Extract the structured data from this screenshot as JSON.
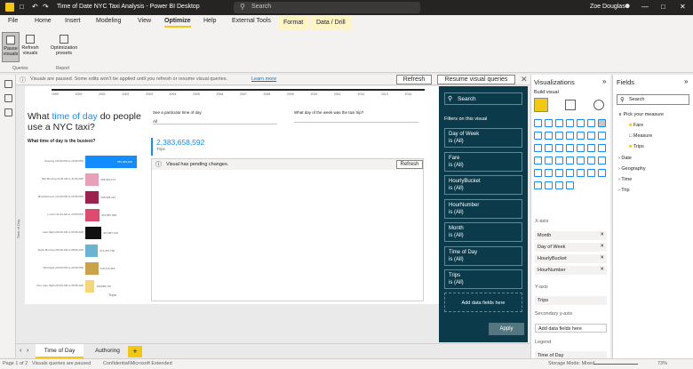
{
  "app": {
    "title": "Time of Date NYC Taxi Analysis - Power BI Desktop",
    "search_placeholder": "Search",
    "user": "Zoe Douglas"
  },
  "tabs": [
    "File",
    "Home",
    "Insert",
    "Modeling",
    "View",
    "Optimize",
    "Help",
    "External Tools",
    "Format",
    "Data / Drill"
  ],
  "ribbon": {
    "pause_label": "Pause visuals",
    "refresh_label": "Refresh visuals",
    "presets_label": "Optimization presets",
    "group_queries": "Queries",
    "group_report": "Report"
  },
  "message": {
    "text": "Visuals are paused. Some edits won't be applied until you refresh or resume visual queries.",
    "link": "Learn more",
    "refresh_btn": "Refresh",
    "resume_btn": "Resume visual queries"
  },
  "timeline": [
    "1999",
    "2000",
    "2001",
    "2002",
    "2003",
    "2004",
    "2005",
    "2006",
    "2007",
    "2008",
    "2009",
    "2010",
    "2011",
    "2012",
    "2013",
    "2014"
  ],
  "report": {
    "title_part1": "What",
    "title_highlight": "time of day",
    "title_part2": "do people use a NYC taxi?",
    "slicer1_label": "See a particular time of day",
    "slicer1_value": "All",
    "slicer2_label": "What day of the week was the taxi trip?",
    "kpi_value": "2,383,658,592",
    "kpi_label": "Trips",
    "pending_text": "Visual has pending changes.",
    "pending_refresh": "Refresh",
    "chart_title": "What time of day is the busiest?",
    "y_axis": "Time of Day",
    "x_axis": "Trips"
  },
  "chart_data": {
    "type": "bar",
    "title": "What time of day is the busiest?",
    "xlabel": "Trips",
    "ylabel": "Time of Day",
    "categories": [
      "Evening (16:00 PM to 19:59 PM)",
      "Mid Morning (9:00 AM to 11:59 AM)",
      "Mid Afternoon (12:00 PM to 15:59 PM)",
      "Lunch (11:00 AM to 13:59 PM)",
      "Late Night (00:00 AM to 03:59 AM)",
      "Early Morning (06:00 AM to 08:59 AM)",
      "Mid Night (20:00 PM to 23:59 PM)",
      "Very Late Night (04:00 AM to 05:59 AM)"
    ],
    "values": [
      555,
      293,
      295,
      312,
      347,
      273,
      279,
      199
    ],
    "value_labels": [
      "555,395,258",
      "293,944,174",
      "295,996,421",
      "312,887,908",
      "347,857,129",
      "273,257,758",
      "279,274,363",
      "199,884,722"
    ],
    "colors": [
      "#118dff",
      "#e8a0b8",
      "#a0204d",
      "#e04a6e",
      "#111111",
      "#69b4d0",
      "#c9a24a",
      "#f5d777"
    ]
  },
  "filters": {
    "search": "Search",
    "header": "Filters on this visual",
    "cards": [
      {
        "name": "Day of Week",
        "value": "is (All)"
      },
      {
        "name": "Fare",
        "value": "is (All)"
      },
      {
        "name": "HourlyBucket",
        "value": "is (All)"
      },
      {
        "name": "HourNumber",
        "value": "is (All)"
      },
      {
        "name": "Month",
        "value": "is (All)"
      },
      {
        "name": "Time of Day",
        "value": "is (All)"
      },
      {
        "name": "Trips",
        "value": "is (All)"
      }
    ],
    "add_fields": "Add data fields here",
    "apply": "Apply"
  },
  "viz": {
    "title": "Visualizations",
    "build": "Build visual",
    "xaxis": "X-axis",
    "xfields": [
      "Month",
      "Day of Week",
      "HourlyBucket",
      "HourNumber"
    ],
    "yaxis": "Y-axis",
    "yfields": [
      "Trips"
    ],
    "secondary": "Secondary y-axis",
    "add_fields": "Add data fields here",
    "legend": "Legend",
    "legend_field": "Time of Day"
  },
  "fields": {
    "title": "Fields",
    "search": "Search",
    "items": [
      "Pick your measure",
      "Fare",
      "Measure",
      "Trips",
      "Date",
      "Geography",
      "Time",
      "Trip"
    ]
  },
  "pagetabs": [
    "Time of Day",
    "Authoring"
  ],
  "status": {
    "page": "Page 1 of 2",
    "paused": "Visuals queries are paused",
    "confidential": "Confidential\\Microsoft Extended",
    "storage": "Storage Mode: Mixed",
    "zoom": "73%"
  }
}
